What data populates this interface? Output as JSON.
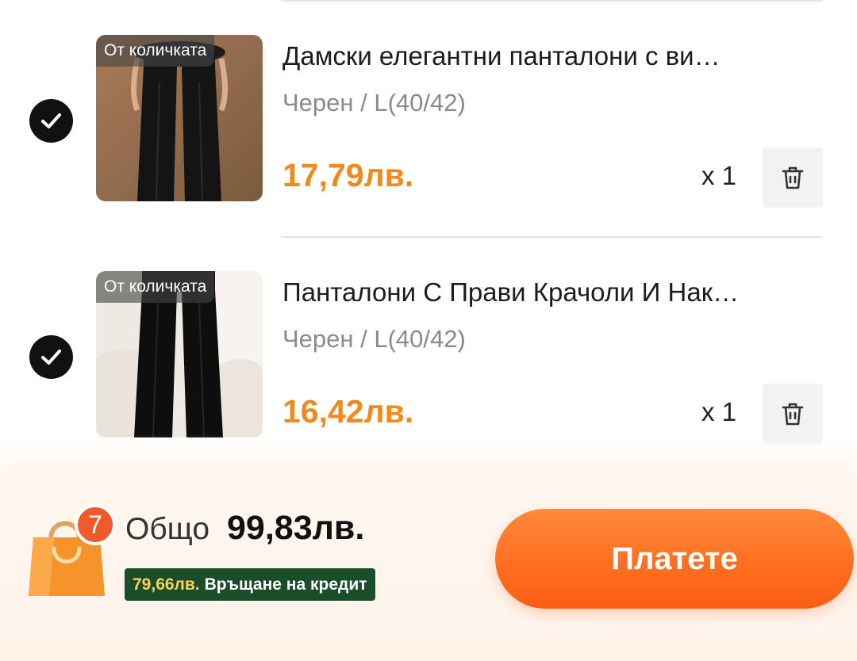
{
  "cart": {
    "items": [
      {
        "tag": "От количката",
        "title": "Дамски елегантни панталони с ви…",
        "variant": "Черен / L(40/42)",
        "price": "17,79лв.",
        "quantity": "x 1",
        "checked": true
      },
      {
        "tag": "От количката",
        "title": "Панталони С Прави Крачоли И Нак…",
        "variant": "Черен / L(40/42)",
        "price": "16,42лв.",
        "quantity": "x 1",
        "checked": true
      }
    ]
  },
  "checkout": {
    "cart_count": "7",
    "total_label": "Общо",
    "total_value": "99,83лв.",
    "credit_amount": "79,66лв.",
    "credit_text": "Връщане на кредит",
    "pay_label": "Платете"
  },
  "colors": {
    "price": "#f08a1c",
    "pay_button": "#ff6d1f",
    "credit_bg": "#1a4d2a",
    "credit_amount": "#f7d35a",
    "badge": "#ef5a2a"
  },
  "icons": {
    "check": "check-circle-icon",
    "trash": "trash-icon",
    "bag": "shopping-bag-icon"
  }
}
